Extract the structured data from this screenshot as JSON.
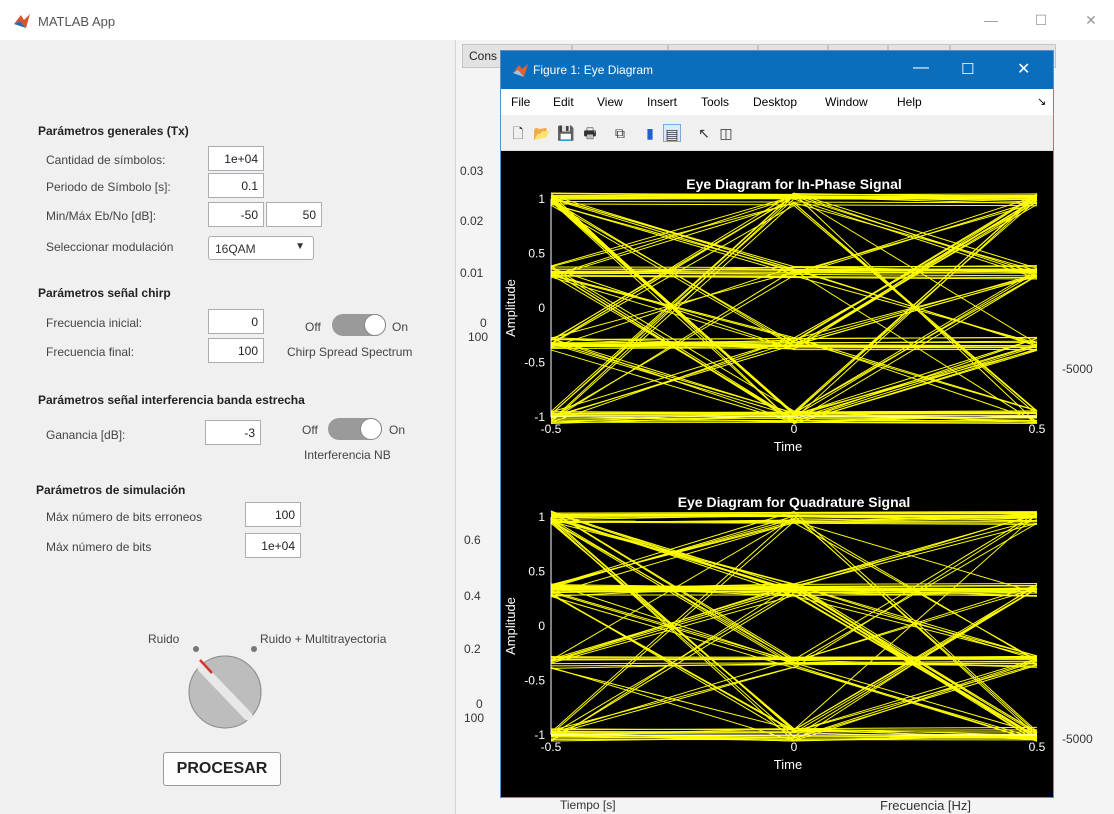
{
  "window": {
    "title": "MATLAB App",
    "minimize": "—",
    "maximize": "☐",
    "close": "✕"
  },
  "tx": {
    "heading": "Parámetros generales (Tx)",
    "n_symbols_label": "Cantidad de símbolos:",
    "n_symbols": "1e+04",
    "period_label": "Periodo de Símbolo [s]:",
    "period": "0.1",
    "ebno_label": "Min/Máx Eb/No [dB]:",
    "ebno_min": "-50",
    "ebno_max": "50",
    "mod_label": "Seleccionar modulación",
    "mod_value": "16QAM"
  },
  "chirp": {
    "heading": "Parámetros señal chirp",
    "f0_label": "Frecuencia inicial:",
    "f0": "0",
    "f1_label": "Frecuencia final:",
    "f1": "100",
    "toggle_off": "Off",
    "toggle_on": "On",
    "toggle_caption": "Chirp Spread Spectrum"
  },
  "nb": {
    "heading": "Parámetros señal interferencia banda estrecha",
    "gain_label": "Ganancia [dB]:",
    "gain": "-3",
    "toggle_off": "Off",
    "toggle_on": "On",
    "toggle_caption": "Interferencia NB"
  },
  "sim": {
    "heading": "Parámetros de simulación",
    "max_err_label": "Máx número de bits erroneos",
    "max_err": "100",
    "max_bits_label": "Máx número de bits",
    "max_bits": "1e+04"
  },
  "knob": {
    "left_label": "Ruido",
    "right_label": "Ruido + Multitrayectoria"
  },
  "process_button": "PROCESAR",
  "tabs": [
    "Cons",
    "",
    "",
    "",
    "",
    "",
    ""
  ],
  "background_axes": {
    "top_yticks": [
      "0.03",
      "0.02",
      "0.01",
      "0",
      "100"
    ],
    "bottom_yticks": [
      "0.6",
      "0.4",
      "0.2",
      "0",
      "100"
    ],
    "right_tick_top": "-5000",
    "right_tick_bottom": "-5000",
    "xlabel_left": "Tiempo [s]",
    "xlabel_right": "Frecuencia [Hz]"
  },
  "figure": {
    "title": "Figure 1: Eye Diagram",
    "menus": [
      "File",
      "Edit",
      "View",
      "Insert",
      "Tools",
      "Desktop",
      "Window",
      "Help"
    ],
    "dock_arrow": "↘"
  },
  "colors": {
    "trace": "#ffff00",
    "accent": "#0b6ebd"
  },
  "chart_data": [
    {
      "type": "line",
      "title": "Eye Diagram for In-Phase Signal",
      "xlabel": "Time",
      "ylabel": "Amplitude",
      "xlim": [
        -0.5,
        0.5
      ],
      "ylim": [
        -1,
        1
      ],
      "xticks": [
        "-0.5",
        "0",
        "0.5"
      ],
      "yticks": [
        "1",
        "0.5",
        "0",
        "-0.5",
        "-1"
      ],
      "levels": [
        -1,
        -0.33,
        0.33,
        1
      ],
      "grid": false
    },
    {
      "type": "line",
      "title": "Eye Diagram for Quadrature Signal",
      "xlabel": "Time",
      "ylabel": "Amplitude",
      "xlim": [
        -0.5,
        0.5
      ],
      "ylim": [
        -1,
        1
      ],
      "xticks": [
        "-0.5",
        "0",
        "0.5"
      ],
      "yticks": [
        "1",
        "0.5",
        "0",
        "-0.5",
        "-1"
      ],
      "levels": [
        -1,
        -0.33,
        0.33,
        1
      ],
      "grid": false
    }
  ]
}
